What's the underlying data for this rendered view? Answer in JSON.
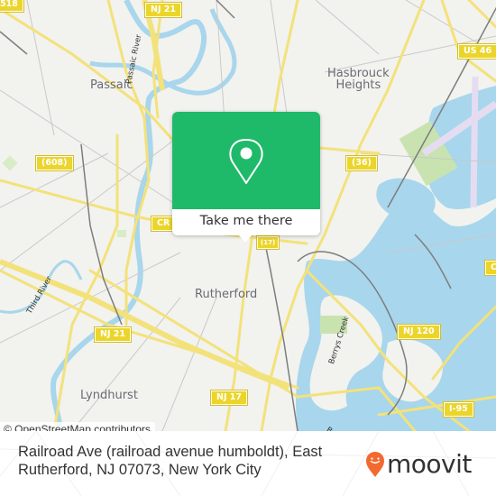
{
  "map": {
    "places": {
      "passaic": "Passaic",
      "hasbrouck_heights": "Hasbrouck\nHeights",
      "rutherford": "Rutherford",
      "lyndhurst": "Lyndhurst"
    },
    "water_labels": {
      "passaic_river": "Passaic River",
      "berrys_creek": "Berrys Creek",
      "third_river": "Third River",
      "berrys_bottom": "Berry"
    },
    "shields": {
      "nj21_top": "NJ 21",
      "us46": "US 46",
      "r608": "(608)",
      "r36": "(36)",
      "cr_left": "CR",
      "cr_right": "C",
      "nj21_bottom": "NJ 21",
      "nj17": "NJ 17",
      "nj120": "NJ 120",
      "i95": "I-95",
      "top_left": "518",
      "center_small": "(17)"
    },
    "attribution": "© OpenStreetMap contributors",
    "colors": {
      "land": "#f2f2ef",
      "water": "#a8d6ec",
      "road": "#f3e27a",
      "shield": "#ecd52b",
      "park": "#c8e3b0",
      "runway": "#e6dcf2",
      "rail": "#777777"
    }
  },
  "popup": {
    "icon": "location-pin-icon",
    "button_label": "Take me there",
    "color": "#1fb96a"
  },
  "footer": {
    "address_line1": "Railroad Ave (railroad avenue humboldt), East",
    "address_line2": "Rutherford, NJ 07073, New York City",
    "logo_text": "moovit",
    "logo_color": "#f26a30"
  }
}
